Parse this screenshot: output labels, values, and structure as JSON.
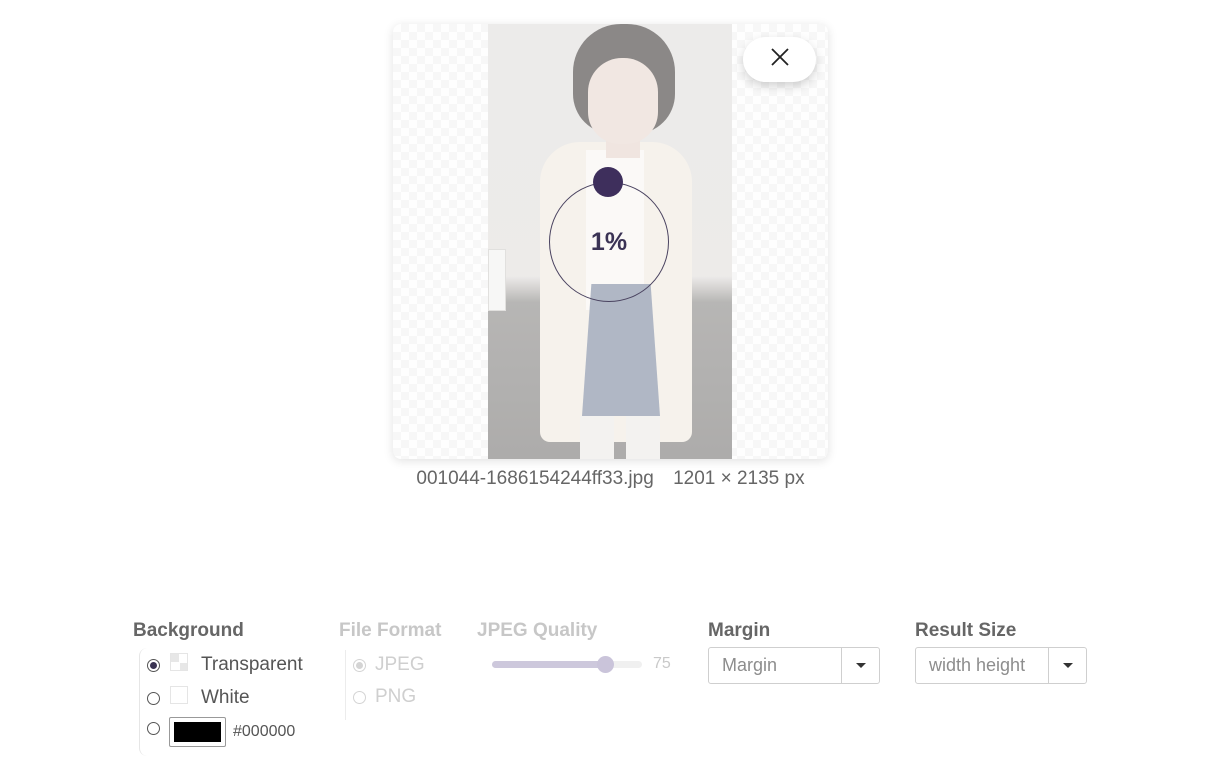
{
  "preview": {
    "progress_text": "1%",
    "close_icon": "close-icon"
  },
  "file": {
    "name": "001044-1686154244ff33.jpg",
    "dimensions": "1201 × 2135 px"
  },
  "options": {
    "background": {
      "label": "Background",
      "items": [
        {
          "label": "Transparent",
          "icon": "transparent-swatch-icon",
          "checked": true
        },
        {
          "label": "White",
          "icon": "white-swatch-icon",
          "checked": false
        },
        {
          "label": "#000000",
          "color": "#000000",
          "checked": false
        }
      ]
    },
    "file_format": {
      "label": "File Format",
      "disabled": true,
      "items": [
        {
          "label": "JPEG",
          "checked": true
        },
        {
          "label": "PNG",
          "checked": false
        }
      ]
    },
    "jpeg_quality": {
      "label": "JPEG Quality",
      "disabled": true,
      "value": "75",
      "max": 100
    },
    "margin": {
      "label": "Margin",
      "placeholder": "Margin"
    },
    "result_size": {
      "label": "Result Size",
      "placeholder": "width height"
    }
  },
  "colors": {
    "accent": "#3e2f5c"
  }
}
